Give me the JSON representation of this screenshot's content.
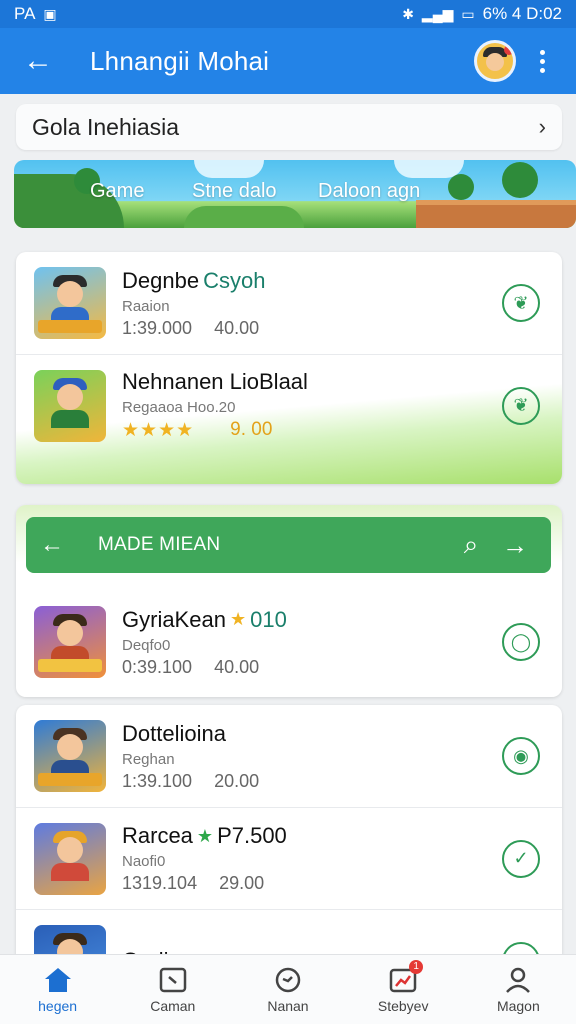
{
  "status_bar": {
    "left_text": "PA",
    "right_text": "6% 4 D:02"
  },
  "app_bar": {
    "title": "Lhnangii Mohai"
  },
  "selector": {
    "label": "Gola Inehiasia"
  },
  "banner": {
    "labels": [
      "Game",
      "Stne dalo",
      "Daloon agn"
    ]
  },
  "card1": {
    "items": [
      {
        "title": "Degnbe",
        "title_accent": "Csyoh",
        "subtitle": "Raaion",
        "meta_a": "1:39.000",
        "meta_b": "40.00"
      },
      {
        "title": "Nehnanen LioBlaal",
        "subtitle": "Regaaoa Hoo.20",
        "stars": "★★★★",
        "rating": "9. 00"
      }
    ]
  },
  "list_header": {
    "title": "MADE MIEAN"
  },
  "card2": {
    "items": [
      {
        "title": "GyriaKean",
        "title_value": "010",
        "subtitle": "Deqfo0",
        "meta_a": "0:39.100",
        "meta_b": "40.00"
      }
    ]
  },
  "card3": {
    "items": [
      {
        "title": "Dottelioina",
        "subtitle": "Reghan",
        "meta_a": "1:39.100",
        "meta_b": "20.00"
      },
      {
        "title": "Rarcea",
        "title_value": "P7.500",
        "subtitle": "Naofi0",
        "meta_a": "1319.104",
        "meta_b": "29.00"
      },
      {
        "title": "Qediners",
        "subtitle": ""
      }
    ]
  },
  "bottom_nav": [
    {
      "label": "hegen"
    },
    {
      "label": "Caman"
    },
    {
      "label": "Nanan"
    },
    {
      "label": "Stebyev",
      "badge": "1"
    },
    {
      "label": "Magon"
    }
  ]
}
